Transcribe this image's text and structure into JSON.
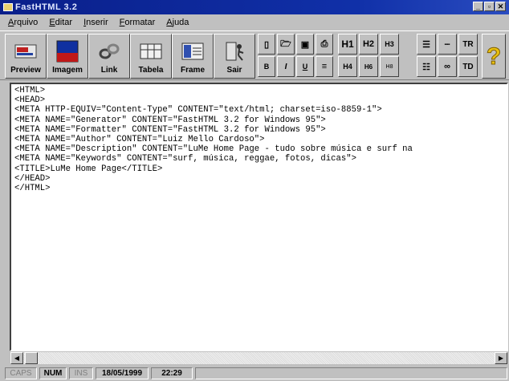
{
  "window": {
    "title": "FastHTML 3.2"
  },
  "menu": [
    {
      "label": "Arquivo",
      "accel": "A",
      "rest": "rquivo"
    },
    {
      "label": "Editar",
      "accel": "E",
      "rest": "ditar"
    },
    {
      "label": "Inserir",
      "accel": "I",
      "rest": "nserir"
    },
    {
      "label": "Formatar",
      "accel": "F",
      "rest": "ormatar"
    },
    {
      "label": "Ajuda",
      "accel": "A",
      "rest": "juda"
    }
  ],
  "toolbar": {
    "preview": "Preview",
    "imagem": "Imagem",
    "link": "Link",
    "tabela": "Tabela",
    "frame": "Frame",
    "sair": "Sair",
    "bold": "B",
    "italic": "I",
    "underline": "U",
    "h1": "H1",
    "h2": "H2",
    "h3": "H3",
    "h4": "H4",
    "h5": "H6",
    "h6": "H8",
    "tr": "TR",
    "td": "TD"
  },
  "editor": {
    "lines": [
      "<HTML>",
      "<HEAD>",
      "<META HTTP-EQUIV=\"Content-Type\" CONTENT=\"text/html; charset=iso-8859-1\">",
      "<META NAME=\"Generator\" CONTENT=\"FastHTML 3.2 for Windows 95\">",
      "<META NAME=\"Formatter\" CONTENT=\"FastHTML 3.2 for Windows 95\">",
      "<META NAME=\"Author\" CONTENT=\"Luiz Mello Cardoso\">",
      "<META NAME=\"Description\" CONTENT=\"LuMe Home Page - tudo sobre música e surf na",
      "<META NAME=\"Keywords\" CONTENT=\"surf, música, reggae, fotos, dicas\">",
      "<TITLE>LuMe Home Page</TITLE>",
      "</HEAD>",
      "</HTML>"
    ]
  },
  "status": {
    "caps": "CAPS",
    "num": "NUM",
    "ins": "INS",
    "date": "18/05/1999",
    "time": "22:29"
  }
}
